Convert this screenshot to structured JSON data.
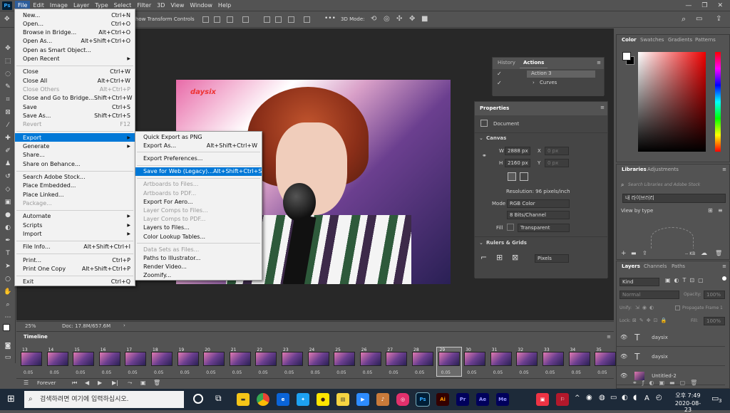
{
  "app": {
    "logo": "Ps"
  },
  "menubar": {
    "items": [
      "File",
      "Edit",
      "Image",
      "Layer",
      "Type",
      "Select",
      "Filter",
      "3D",
      "View",
      "Window",
      "Help"
    ],
    "active": "File",
    "window_buttons": [
      "—",
      "❐",
      "✕"
    ]
  },
  "optbar": {
    "transform_label": "how Transform Controls",
    "mode_label": "3D Mode:",
    "more": "•••"
  },
  "file_menu": {
    "items": [
      {
        "label": "New...",
        "shortcut": "Ctrl+N"
      },
      {
        "label": "Open...",
        "shortcut": "Ctrl+O"
      },
      {
        "label": "Browse in Bridge...",
        "shortcut": "Alt+Ctrl+O"
      },
      {
        "label": "Open As...",
        "shortcut": "Alt+Shift+Ctrl+O"
      },
      {
        "label": "Open as Smart Object...",
        "shortcut": ""
      },
      {
        "label": "Open Recent",
        "shortcut": "",
        "submenu": true
      },
      {
        "sep": true
      },
      {
        "label": "Close",
        "shortcut": "Ctrl+W"
      },
      {
        "label": "Close All",
        "shortcut": "Alt+Ctrl+W"
      },
      {
        "label": "Close Others",
        "shortcut": "Alt+Ctrl+P",
        "disabled": true
      },
      {
        "label": "Close and Go to Bridge...",
        "shortcut": "Shift+Ctrl+W"
      },
      {
        "label": "Save",
        "shortcut": "Ctrl+S"
      },
      {
        "label": "Save As...",
        "shortcut": "Shift+Ctrl+S"
      },
      {
        "label": "Revert",
        "shortcut": "F12",
        "disabled": true
      },
      {
        "sep": true
      },
      {
        "label": "Export",
        "shortcut": "",
        "submenu": true,
        "highlight": true
      },
      {
        "label": "Generate",
        "shortcut": "",
        "submenu": true
      },
      {
        "label": "Share...",
        "shortcut": ""
      },
      {
        "label": "Share on Behance...",
        "shortcut": ""
      },
      {
        "sep": true
      },
      {
        "label": "Search Adobe Stock...",
        "shortcut": ""
      },
      {
        "label": "Place Embedded...",
        "shortcut": ""
      },
      {
        "label": "Place Linked...",
        "shortcut": ""
      },
      {
        "label": "Package...",
        "shortcut": "",
        "disabled": true
      },
      {
        "sep": true
      },
      {
        "label": "Automate",
        "shortcut": "",
        "submenu": true
      },
      {
        "label": "Scripts",
        "shortcut": "",
        "submenu": true
      },
      {
        "label": "Import",
        "shortcut": "",
        "submenu": true
      },
      {
        "sep": true
      },
      {
        "label": "File Info...",
        "shortcut": "Alt+Shift+Ctrl+I"
      },
      {
        "sep": true
      },
      {
        "label": "Print...",
        "shortcut": "Ctrl+P"
      },
      {
        "label": "Print One Copy",
        "shortcut": "Alt+Shift+Ctrl+P"
      },
      {
        "sep": true
      },
      {
        "label": "Exit",
        "shortcut": "Ctrl+Q"
      }
    ]
  },
  "export_submenu": {
    "items": [
      {
        "label": "Quick Export as PNG",
        "shortcut": ""
      },
      {
        "label": "Export As...",
        "shortcut": "Alt+Shift+Ctrl+W"
      },
      {
        "sep": true
      },
      {
        "label": "Export Preferences...",
        "shortcut": ""
      },
      {
        "sep": true
      },
      {
        "label": "Save for Web (Legacy)...",
        "shortcut": "Alt+Shift+Ctrl+S",
        "highlight": true
      },
      {
        "sep": true
      },
      {
        "label": "Artboards to Files...",
        "shortcut": "",
        "disabled": true
      },
      {
        "label": "Artboards to PDF...",
        "shortcut": "",
        "disabled": true
      },
      {
        "label": "Export For Aero...",
        "shortcut": ""
      },
      {
        "label": "Layer Comps to Files...",
        "shortcut": "",
        "disabled": true
      },
      {
        "label": "Layer Comps to PDF...",
        "shortcut": "",
        "disabled": true
      },
      {
        "label": "Layers to Files...",
        "shortcut": ""
      },
      {
        "label": "Color Lookup Tables...",
        "shortcut": ""
      },
      {
        "sep": true
      },
      {
        "label": "Data Sets as Files...",
        "shortcut": "",
        "disabled": true
      },
      {
        "label": "Paths to Illustrator...",
        "shortcut": ""
      },
      {
        "label": "Render Video...",
        "shortcut": ""
      },
      {
        "label": "Zoomify...",
        "shortcut": ""
      }
    ]
  },
  "canvas": {
    "watermark": "daysix"
  },
  "status": {
    "zoom": "25%",
    "doc": "Doc: 17.8M/657.6M"
  },
  "history_panel": {
    "tabs": [
      "History",
      "Actions"
    ],
    "active": "Actions",
    "rows": [
      "Action 3",
      "Curves"
    ]
  },
  "properties": {
    "title": "Properties",
    "doc_label": "Document",
    "canvas_section": "Canvas",
    "w_label": "W",
    "w_value": "2888 px",
    "h_label": "H",
    "h_value": "2160 px",
    "x_label": "X",
    "x_value": "0 px",
    "y_label": "Y",
    "y_value": "0 px",
    "resolution": "Resolution: 96 pixels/inch",
    "mode_label": "Mode",
    "mode_value": "RGB Color",
    "bits_value": "8 Bits/Channel",
    "fill_label": "Fill",
    "fill_value": "Transparent",
    "rulers_section": "Rulers & Grids",
    "units_value": "Pixels"
  },
  "color_panel": {
    "tabs": [
      "Color",
      "Swatches",
      "Gradients",
      "Patterns"
    ],
    "active": "Color"
  },
  "libraries": {
    "tabs": [
      "Libraries",
      "Adjustments"
    ],
    "active": "Libraries",
    "search_placeholder": "Search Libraries and Adobe Stock",
    "library_name": "내 라이브러리",
    "view_by": "View by type",
    "size": "-- KB"
  },
  "layers": {
    "tabs": [
      "Layers",
      "Channels",
      "Paths"
    ],
    "active": "Layers",
    "kind": "Kind",
    "blend": "Normal",
    "opacity_label": "Opacity:",
    "opacity_value": "100%",
    "unify": "Unify:",
    "propagate": "Propagate Frame 1",
    "lock": "Lock:",
    "fill_label": "Fill:",
    "fill_value": "100%",
    "rows": [
      {
        "name": "daysix",
        "type": "T"
      },
      {
        "name": "daysix",
        "type": "T"
      },
      {
        "name": "Untitled-2",
        "type": "img"
      }
    ]
  },
  "timeline": {
    "title": "Timeline",
    "loop": "Forever",
    "frames": [
      {
        "n": "13",
        "d": "0.05"
      },
      {
        "n": "14",
        "d": "0.05"
      },
      {
        "n": "15",
        "d": "0.05"
      },
      {
        "n": "16",
        "d": "0.05"
      },
      {
        "n": "17",
        "d": "0.05"
      },
      {
        "n": "18",
        "d": "0.05"
      },
      {
        "n": "19",
        "d": "0.05"
      },
      {
        "n": "20",
        "d": "0.05"
      },
      {
        "n": "21",
        "d": "0.05"
      },
      {
        "n": "22",
        "d": "0.05"
      },
      {
        "n": "23",
        "d": "0.05"
      },
      {
        "n": "24",
        "d": "0.05"
      },
      {
        "n": "25",
        "d": "0.05"
      },
      {
        "n": "26",
        "d": "0.05"
      },
      {
        "n": "27",
        "d": "0.05"
      },
      {
        "n": "28",
        "d": "0.05"
      },
      {
        "n": "29",
        "d": "0.05"
      },
      {
        "n": "30",
        "d": "0.05"
      },
      {
        "n": "31",
        "d": "0.05"
      },
      {
        "n": "32",
        "d": "0.05"
      },
      {
        "n": "33",
        "d": "0.05"
      },
      {
        "n": "34",
        "d": "0.05"
      },
      {
        "n": "35",
        "d": "0.05"
      }
    ],
    "selected": "29"
  },
  "taskbar": {
    "search_placeholder": "검색하려면 여기에 입력하십시오.",
    "apps": [
      {
        "label": "Ps",
        "color": "#001e36",
        "fg": "#31a8ff"
      },
      {
        "label": "Ai",
        "color": "#330000",
        "fg": "#ff9a00"
      },
      {
        "label": "Pr",
        "color": "#00005b",
        "fg": "#9999ff"
      },
      {
        "label": "Ae",
        "color": "#00005b",
        "fg": "#9999ff"
      },
      {
        "label": "Me",
        "color": "#00005b",
        "fg": "#9999ff"
      }
    ],
    "ime": "A",
    "time": "오후 7:49",
    "date": "2020-08-23",
    "notifications": "3"
  }
}
